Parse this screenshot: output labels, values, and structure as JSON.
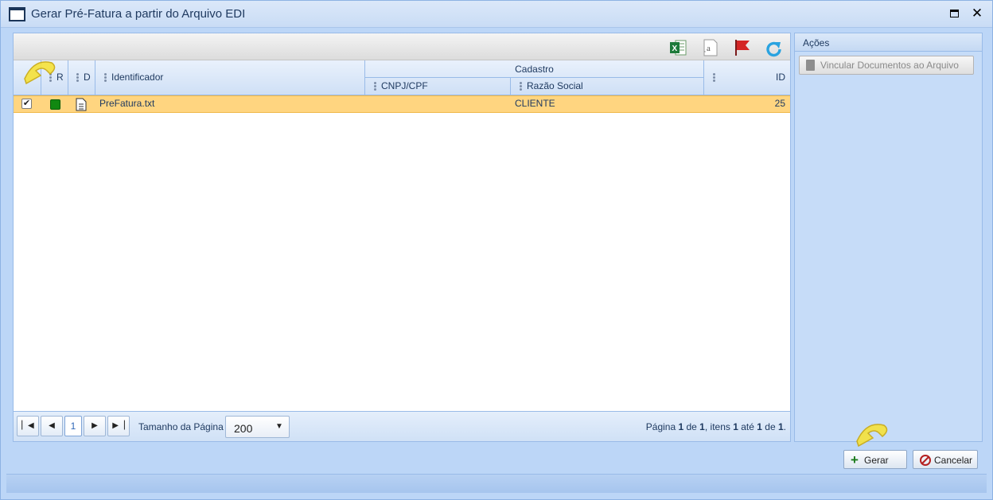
{
  "window": {
    "title": "Gerar Pré-Fatura a partir do Arquivo EDI"
  },
  "toolbar": {
    "icons": [
      "excel-export-icon",
      "text-format-icon",
      "flag-icon",
      "refresh-icon"
    ]
  },
  "grid": {
    "columns": {
      "col_r": "R",
      "col_d": "D",
      "identificador": "Identificador",
      "cadastro": "Cadastro",
      "cnpj_cpf": "CNPJ/CPF",
      "razao_social": "Razão Social",
      "id": "ID"
    },
    "rows": [
      {
        "checked": true,
        "status_color": "#118811",
        "identificador": "PreFatura.txt",
        "cnpj_cpf": "",
        "razao_social": "CLIENTE",
        "id": "25"
      }
    ]
  },
  "pager": {
    "current_page": "1",
    "page_size_label": "Tamanho da Página",
    "page_size": "200",
    "info": {
      "prefix": "Página ",
      "page": "1",
      "of": " de ",
      "total_pages": "1",
      "items_text": ", itens ",
      "from": "1",
      "to_text": " até ",
      "to": "1",
      "of2": " de ",
      "total": "1",
      "suffix": "."
    }
  },
  "actions": {
    "title": "Ações",
    "vincular_label": "Vincular Documentos ao Arquivo"
  },
  "footer": {
    "gerar_label": "Gerar",
    "cancelar_label": "Cancelar"
  },
  "colors": {
    "selected_row": "#ffd580",
    "panel_bg": "#bcd6f7",
    "accent": "#99bbe8"
  }
}
